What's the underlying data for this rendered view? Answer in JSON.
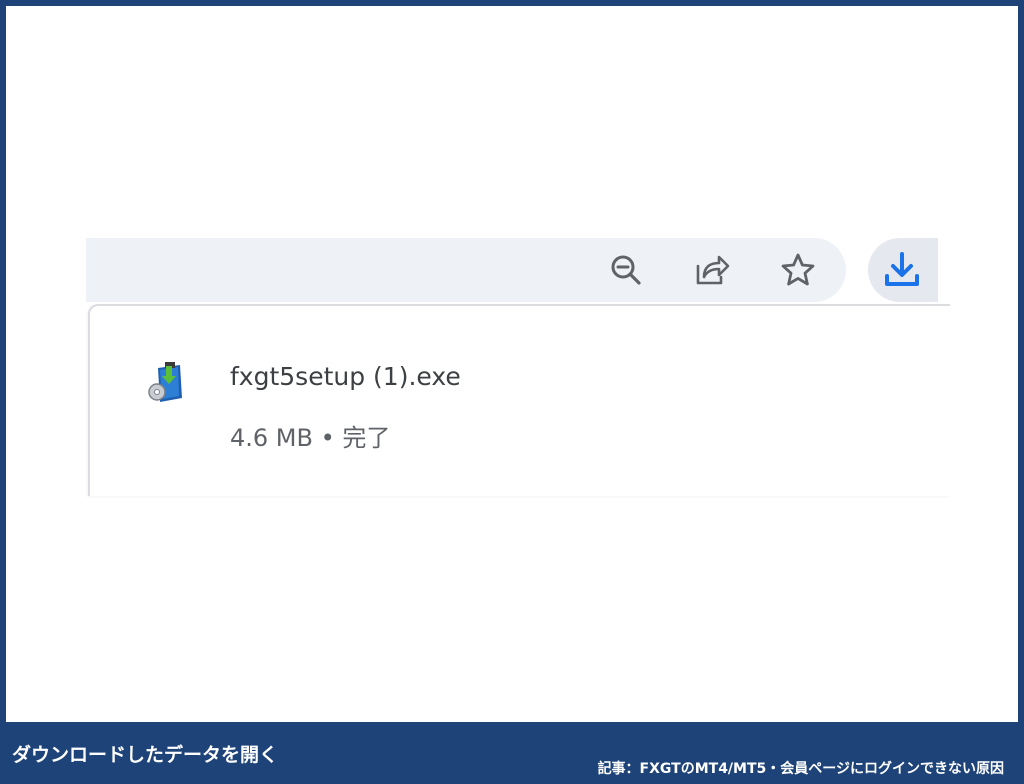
{
  "toolbar": {
    "icons": [
      "zoom-out-icon",
      "share-icon",
      "star-icon"
    ],
    "download_icon": "download-icon"
  },
  "download_item": {
    "icon": "installer-package-icon",
    "file_name": "fxgt5setup (1).exe",
    "status": "4.6 MB • 完了"
  },
  "caption": {
    "left": "ダウンロードしたデータを開く",
    "right": "記事：FXGTのMT4/MT5・会員ページにログインできない原因"
  },
  "colors": {
    "frame_border": "#1e4379",
    "toolbar_bg": "#eef1f6",
    "download_accent": "#1a73e8",
    "icon_gray": "#5f6368"
  }
}
